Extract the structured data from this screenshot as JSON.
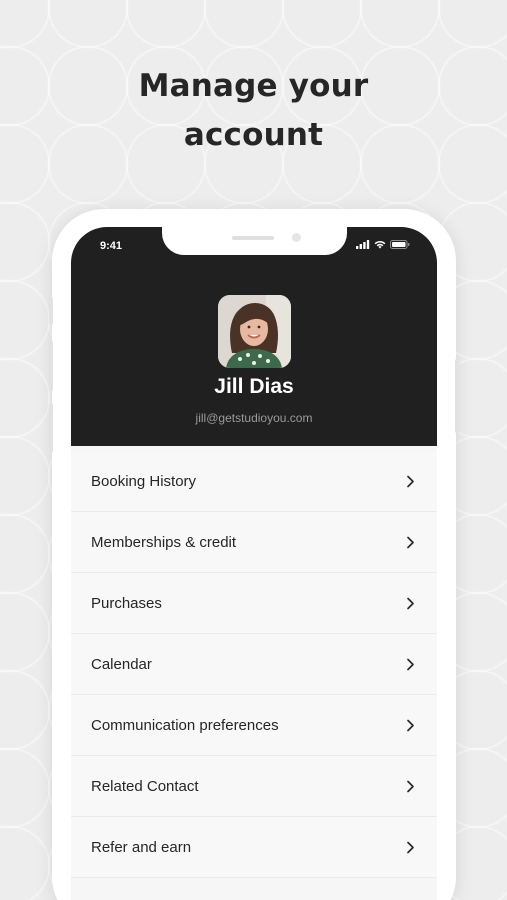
{
  "headline": {
    "line1": "Manage your",
    "line2": "account"
  },
  "status_bar": {
    "time": "9:41",
    "icons": [
      "signal-icon",
      "wifi-icon",
      "battery-icon"
    ]
  },
  "profile": {
    "name": "Jill Dias",
    "email": "jill@getstudioyou.com"
  },
  "menu": {
    "items": [
      {
        "label": "Booking History",
        "icon": "chevron-right-icon"
      },
      {
        "label": "Memberships & credit",
        "icon": "chevron-right-icon"
      },
      {
        "label": "Purchases",
        "icon": "chevron-right-icon"
      },
      {
        "label": "Calendar",
        "icon": "chevron-right-icon"
      },
      {
        "label": "Communication preferences",
        "icon": "chevron-right-icon"
      },
      {
        "label": "Related Contact",
        "icon": "chevron-right-icon"
      },
      {
        "label": "Refer and earn",
        "icon": "chevron-right-icon"
      }
    ]
  },
  "colors": {
    "header_background": "#202020",
    "page_background": "#ededed",
    "text_primary": "#262626"
  }
}
